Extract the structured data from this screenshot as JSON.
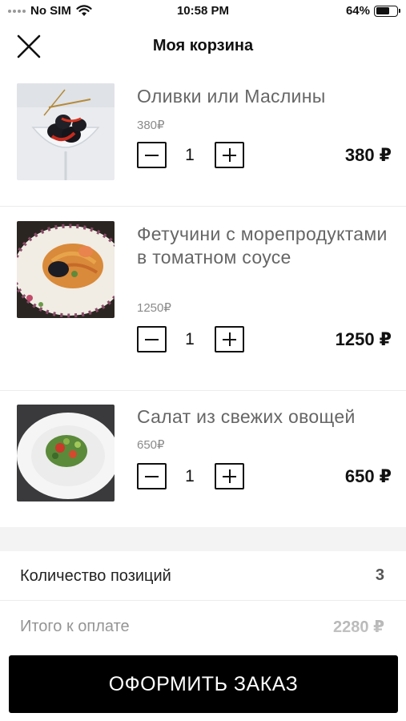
{
  "status_bar": {
    "carrier": "No SIM",
    "time": "10:58 PM",
    "battery": "64%",
    "battery_level": 0.64
  },
  "header": {
    "title": "Моя корзина",
    "close_icon": "close-icon"
  },
  "cart": {
    "items": [
      {
        "name": "Оливки или Маслины",
        "unit_price": "380₽",
        "quantity": "1",
        "total": "380 ₽"
      },
      {
        "name": "Фетучини с морепродуктами в томатном соусе",
        "unit_price": "1250₽",
        "quantity": "1",
        "total": "1250 ₽"
      },
      {
        "name": "Салат из свежих овощей",
        "unit_price": "650₽",
        "quantity": "1",
        "total": "650 ₽"
      }
    ],
    "decrement_icon": "minus-icon",
    "increment_icon": "plus-icon"
  },
  "summary": {
    "count_label": "Количество позиций",
    "count_value": "3",
    "total_label": "Итого к оплате",
    "total_value": "2280 ₽"
  },
  "checkout_button": "ОФОРМИТЬ ЗАКАЗ"
}
